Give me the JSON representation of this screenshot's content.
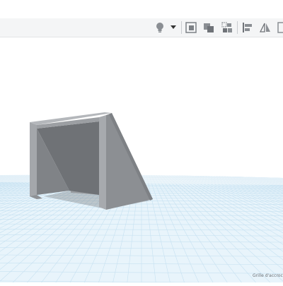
{
  "toolbar": {
    "buttons": [
      {
        "icon": "lightbulb-icon",
        "name": "show-notes-button"
      },
      {
        "icon": "dropdown-arrow-icon",
        "name": "notes-menu-button"
      },
      {
        "icon": "frame-icon",
        "name": "show-all-button"
      },
      {
        "icon": "group-icon",
        "name": "group-button"
      },
      {
        "icon": "ungroup-icon",
        "name": "ungroup-button"
      },
      {
        "icon": "align-icon",
        "name": "align-button"
      },
      {
        "icon": "mirror-icon",
        "name": "mirror-button"
      },
      {
        "icon": "scale-icon",
        "name": "more-tools-button"
      }
    ]
  },
  "workplane": {
    "status_label": "Grille d'accroc"
  },
  "colors": {
    "grid_bg": "#eaf5fb",
    "grid_line": "#bcdcef",
    "object_light": "#a8acb0",
    "object_mid": "#8b8f94",
    "object_dark": "#76797d"
  }
}
